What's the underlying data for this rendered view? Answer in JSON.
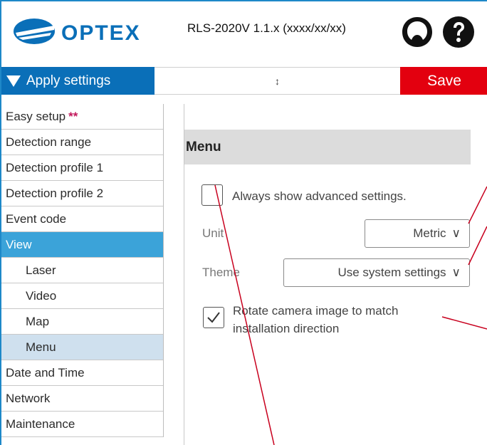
{
  "header": {
    "brand": "OPTEX",
    "title": "RLS-2020V 1.1.x (xxxx/xx/xx)",
    "icons": [
      "account-icon",
      "help-icon"
    ]
  },
  "toolbar": {
    "apply_label": "Apply settings",
    "resize_glyph": "↕",
    "save_label": "Save"
  },
  "sidebar": {
    "items": [
      {
        "label": "Easy setup",
        "badge": "**"
      },
      {
        "label": "Detection range"
      },
      {
        "label": "Detection profile 1"
      },
      {
        "label": "Detection profile 2"
      },
      {
        "label": "Event code"
      },
      {
        "label": "View",
        "state": "active"
      },
      {
        "label": "Laser",
        "sub": true
      },
      {
        "label": "Video",
        "sub": true
      },
      {
        "label": "Map",
        "sub": true
      },
      {
        "label": "Menu",
        "sub": true,
        "state": "selected"
      },
      {
        "label": "Date and Time"
      },
      {
        "label": "Network"
      },
      {
        "label": "Maintenance"
      }
    ]
  },
  "main": {
    "section_title": "Menu",
    "advanced": {
      "label": "Always show advanced settings.",
      "checked": false
    },
    "unit": {
      "label": "Unit",
      "value": "Metric"
    },
    "theme": {
      "label": "Theme",
      "value": "Use system settings"
    },
    "rotate": {
      "line1": "Rotate camera image to match",
      "line2": "installation direction",
      "checked": true
    }
  },
  "colors": {
    "brand_blue": "#0a6fb8",
    "active_nav": "#3ba3d9",
    "selected_nav": "#cfe0ee",
    "save_red": "#e3000f",
    "annotation_red": "#c8001e"
  }
}
